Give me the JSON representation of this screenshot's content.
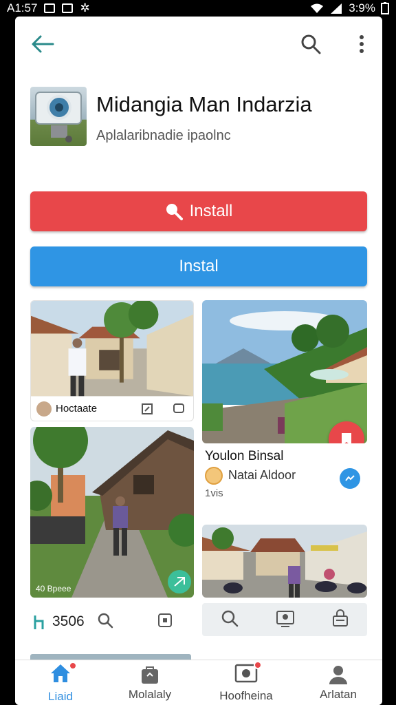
{
  "status_bar": {
    "time": "A1:57",
    "battery": "3:9%"
  },
  "app": {
    "title": "Midangia Man Indarzia",
    "subtitle": "Aplalaribnadie ipaolnc"
  },
  "buttons": {
    "install_primary": "Install",
    "install_secondary": "Instal"
  },
  "tiles": {
    "tile1_caption": "Hoctaate",
    "tile2_caption": "Youlon Binsal",
    "tile2_author": "Natai Aldoor",
    "tile2_meta": "1vis",
    "tile3_caption": "40 Bpeee",
    "count_label": "3506"
  },
  "bottom_nav": {
    "items": [
      {
        "label": "Liaid",
        "icon": "home-icon"
      },
      {
        "label": "Molalaly",
        "icon": "bag-icon"
      },
      {
        "label": "Hoofheina",
        "icon": "image-icon"
      },
      {
        "label": "Arlatan",
        "icon": "person-icon"
      }
    ]
  },
  "colors": {
    "install_red": "#e8474a",
    "install_blue": "#2f95e4",
    "accent_teal": "#2a8a8a",
    "nav_active": "#2f8ee0"
  }
}
